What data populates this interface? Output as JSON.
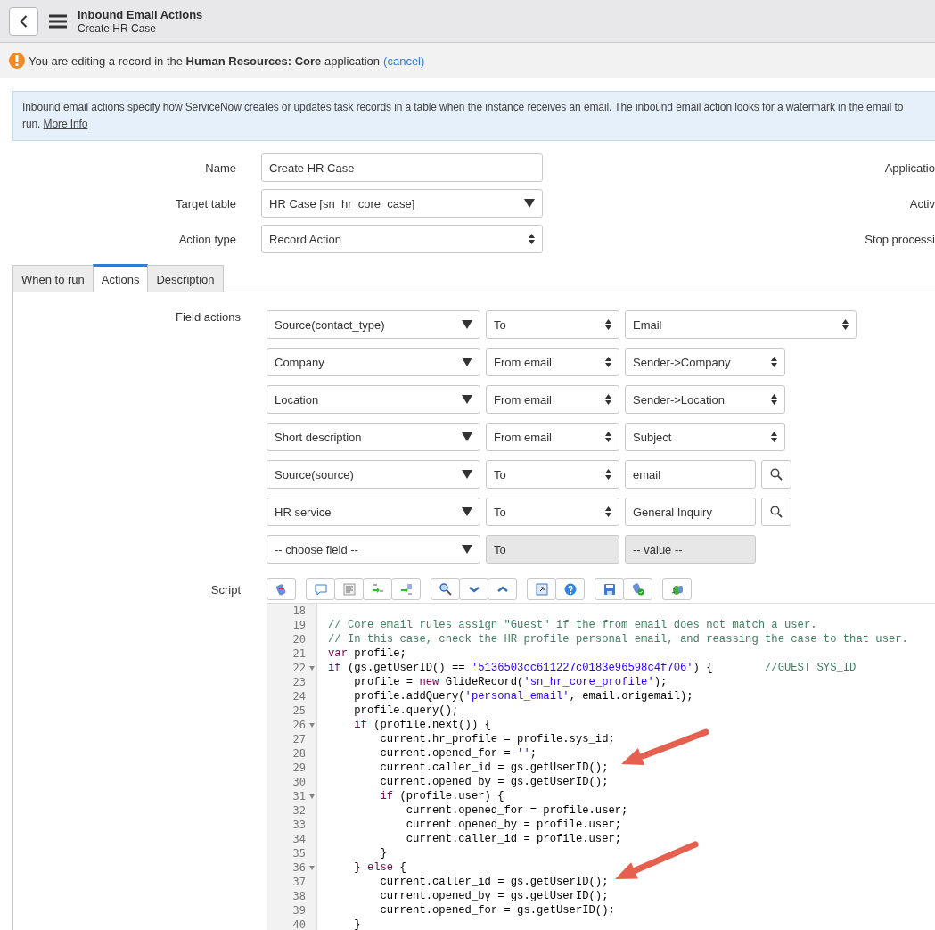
{
  "header": {
    "title": "Inbound Email Actions",
    "subtitle": "Create HR Case"
  },
  "notice": {
    "text": "You are editing a record in the **Human Resources: Core** application",
    "link": "(cancel)"
  },
  "info": {
    "text": "Inbound email actions specify how ServiceNow creates or updates task records in a table when the instance receives an email. The inbound email action looks for a watermark in the email to run.",
    "link": "More Info"
  },
  "form": [
    {
      "label": "Name",
      "value": "Create HR Case",
      "kind": "text",
      "side_label": "Applicatio"
    },
    {
      "label": "Target table",
      "value": "HR Case [sn_hr_core_case]",
      "kind": "dropdown",
      "side_label": "Activ"
    },
    {
      "label": "Action type",
      "value": "Record Action",
      "kind": "select",
      "side_label": "Stop processi"
    }
  ],
  "tabs": [
    {
      "label": "When to run",
      "selected": false
    },
    {
      "label": "Actions",
      "selected": true
    },
    {
      "label": "Description",
      "selected": false
    }
  ],
  "field_actions": {
    "label": "Field actions",
    "rows": [
      {
        "field": "Source(contact_type)",
        "operator": "To",
        "value": "Email",
        "kind": "select"
      },
      {
        "field": "Company",
        "operator": "From email",
        "value": "Sender->Company",
        "kind": "select_short"
      },
      {
        "field": "Location",
        "operator": "From email",
        "value": "Sender->Location",
        "kind": "select_short"
      },
      {
        "field": "Short description",
        "operator": "From email",
        "value": "Subject",
        "kind": "select_short"
      },
      {
        "field": "Source(source)",
        "operator": "To",
        "value": "email",
        "kind": "reference"
      },
      {
        "field": "HR service",
        "operator": "To",
        "value": "General Inquiry",
        "kind": "reference"
      },
      {
        "field": "-- choose field --",
        "operator": "To",
        "value": "-- value --",
        "kind": "disabled"
      }
    ]
  },
  "script": {
    "label": "Script",
    "lines": [
      {
        "number": "18",
        "foldable": false
      },
      {
        "number": "19",
        "foldable": false,
        "tokens": [
          {
            "kind": "comment",
            "text": "// Core email rules assign \"Guest\" if the from email does not match a user."
          }
        ]
      },
      {
        "number": "20",
        "foldable": false,
        "tokens": [
          {
            "kind": "comment",
            "text": "// In this case, check the HR profile personal email, and reassing the case to that user."
          }
        ]
      },
      {
        "number": "21",
        "foldable": false,
        "tokens": [
          {
            "kind": "keyword",
            "text": "var"
          },
          {
            "kind": "plain",
            "text": " profile;"
          }
        ]
      },
      {
        "number": "22",
        "foldable": true,
        "tokens": [
          {
            "kind": "keyword",
            "text": "if"
          },
          {
            "kind": "plain",
            "text": " (gs.getUserID() == "
          },
          {
            "kind": "string",
            "text": "'5136503cc611227c0183e96598c4f706'"
          },
          {
            "kind": "plain",
            "text": ") {        "
          },
          {
            "kind": "comment",
            "text": "//GUEST SYS_ID"
          }
        ]
      },
      {
        "number": "23",
        "foldable": false,
        "tokens": [
          {
            "kind": "plain",
            "text": "    profile = "
          },
          {
            "kind": "keyword",
            "text": "new"
          },
          {
            "kind": "plain",
            "text": " GlideRecord("
          },
          {
            "kind": "string",
            "text": "'sn_hr_core_profile'"
          },
          {
            "kind": "plain",
            "text": ");"
          }
        ]
      },
      {
        "number": "24",
        "foldable": false,
        "tokens": [
          {
            "kind": "plain",
            "text": "    profile.addQuery("
          },
          {
            "kind": "string",
            "text": "'personal_email'"
          },
          {
            "kind": "plain",
            "text": ", email.origemail);"
          }
        ]
      },
      {
        "number": "25",
        "foldable": false,
        "tokens": [
          {
            "kind": "plain",
            "text": "    profile.query();"
          }
        ]
      },
      {
        "number": "26",
        "foldable": true,
        "tokens": [
          {
            "kind": "keyword",
            "text": "    if"
          },
          {
            "kind": "plain",
            "text": " (profile.next()) {"
          }
        ]
      },
      {
        "number": "27",
        "foldable": false,
        "tokens": [
          {
            "kind": "plain",
            "text": "        current.hr_profile = profile.sys_id;"
          }
        ]
      },
      {
        "number": "28",
        "foldable": false,
        "tokens": [
          {
            "kind": "plain",
            "text": "        current.opened_for = "
          },
          {
            "kind": "string",
            "text": "''"
          },
          {
            "kind": "plain",
            "text": ";"
          }
        ]
      },
      {
        "number": "29",
        "foldable": false,
        "tokens": [
          {
            "kind": "plain",
            "text": "        current.caller_id = gs.getUserID();"
          }
        ]
      },
      {
        "number": "30",
        "foldable": false,
        "tokens": [
          {
            "kind": "plain",
            "text": "        current.opened_by = gs.getUserID();"
          }
        ]
      },
      {
        "number": "31",
        "foldable": true,
        "tokens": [
          {
            "kind": "keyword",
            "text": "        if"
          },
          {
            "kind": "plain",
            "text": " (profile.user) {"
          }
        ]
      },
      {
        "number": "32",
        "foldable": false,
        "tokens": [
          {
            "kind": "plain",
            "text": "            current.opened_for = profile.user;"
          }
        ]
      },
      {
        "number": "33",
        "foldable": false,
        "tokens": [
          {
            "kind": "plain",
            "text": "            current.opened_by = profile.user;"
          }
        ]
      },
      {
        "number": "34",
        "foldable": false,
        "tokens": [
          {
            "kind": "plain",
            "text": "            current.caller_id = profile.user;"
          }
        ]
      },
      {
        "number": "35",
        "foldable": false,
        "tokens": [
          {
            "kind": "plain",
            "text": "        }"
          }
        ]
      },
      {
        "number": "36",
        "foldable": true,
        "tokens": [
          {
            "kind": "plain",
            "text": "    } "
          },
          {
            "kind": "keyword",
            "text": "else"
          },
          {
            "kind": "plain",
            "text": " {"
          }
        ]
      },
      {
        "number": "37",
        "foldable": false,
        "tokens": [
          {
            "kind": "plain",
            "text": "        current.caller_id = gs.getUserID();"
          }
        ]
      },
      {
        "number": "38",
        "foldable": false,
        "tokens": [
          {
            "kind": "plain",
            "text": "        current.opened_by = gs.getUserID();"
          }
        ]
      },
      {
        "number": "39",
        "foldable": false,
        "tokens": [
          {
            "kind": "plain",
            "text": "        current.opened_for = gs.getUserID();"
          }
        ]
      },
      {
        "number": "40",
        "foldable": false,
        "tokens": [
          {
            "kind": "plain",
            "text": "    }"
          }
        ]
      }
    ]
  }
}
